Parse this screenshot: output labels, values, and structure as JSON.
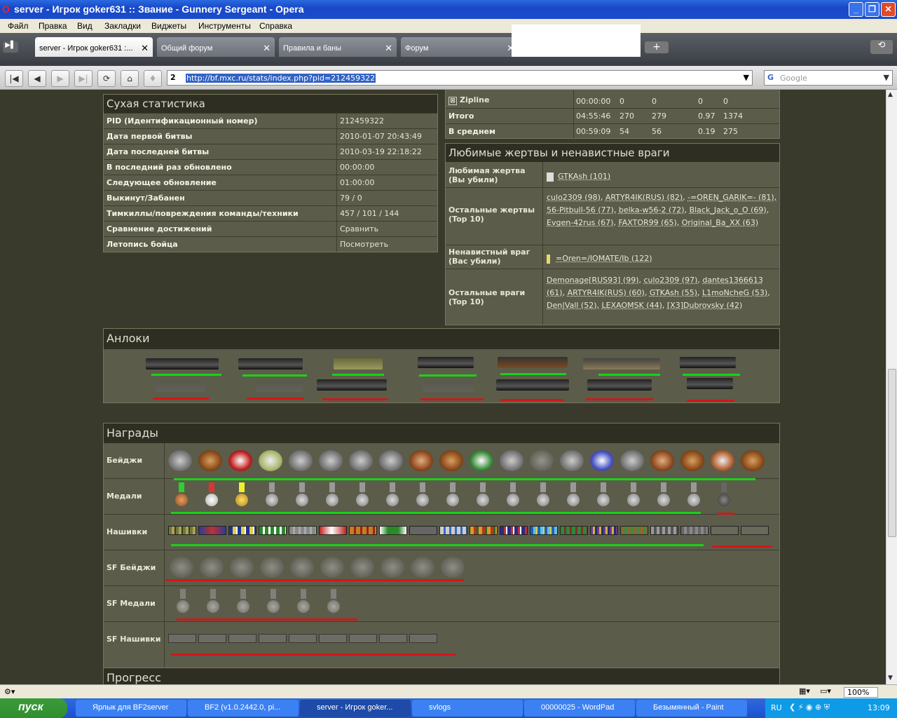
{
  "window": {
    "title": "server - Игрок goker631 :: Звание - Gunnery Sergeant - Opera",
    "logo": "O"
  },
  "menu": [
    "Файл",
    "Правка",
    "Вид",
    "Закладки",
    "Виджеты",
    "Инструменты",
    "Справка"
  ],
  "tabs": [
    {
      "label": "server - Игрок goker631 :..."
    },
    {
      "label": "Общий форум"
    },
    {
      "label": "Правила и баны"
    },
    {
      "label": "Форум"
    }
  ],
  "address": {
    "url": "http://bf.mxc.ru/stats/index.php?pid=212459322"
  },
  "search": {
    "placeholder": "Google"
  },
  "dry_stats": {
    "title": "Сухая статистика",
    "rows": [
      {
        "k": "PID (Идентификационный номер)",
        "v": "212459322"
      },
      {
        "k": "Дата первой битвы",
        "v": "2010-01-07 20:43:49"
      },
      {
        "k": "Дата последней битвы",
        "v": "2010-03-19 22:18:22"
      },
      {
        "k": "В последний раз обновлено",
        "v": "00:00:00"
      },
      {
        "k": "Следующее обновление",
        "v": "01:00:00"
      },
      {
        "k": "Выкинут/Забанен",
        "v": "79 / 0"
      },
      {
        "k": "Тимкиллы/повреждения команды/техники",
        "v": "457 / 101 / 144"
      },
      {
        "k": "Сравнение достижений",
        "v": "Сравнить"
      },
      {
        "k": "Летопись бойца",
        "v": "Посмотреть"
      }
    ]
  },
  "vehicle_rows": [
    {
      "name": "Zipline",
      "time": "00:00:00",
      "a": "0",
      "b": "0",
      "c": "0",
      "d": "0"
    },
    {
      "name": "Итого",
      "time": "04:55:46",
      "a": "270",
      "b": "279",
      "c": "0.97",
      "d": "1374"
    },
    {
      "name": "В среднем",
      "time": "00:59:09",
      "a": "54",
      "b": "56",
      "c": "0.19",
      "d": "275"
    }
  ],
  "enemies": {
    "title": "Любимые жертвы и ненавистные враги",
    "fav_victim_label": "Любимая жертва (Вы убили)",
    "fav_victim": "GTKAsh (101)",
    "other_victims_label": "Остальные жертвы (Top 10)",
    "other_victims": [
      "culo2309 (98),",
      "ARTYR4IK(RUS) (82),",
      "-=OREN_GARIK=- (81),",
      "56-Pitbull-56 (77),",
      "belka-w56-2 (72),",
      "Black_Jack_o_O (69),",
      "Evgen-42rus (67),",
      "FAXTOR99 (65),",
      "Original_Ba_XX (63)"
    ],
    "hated_label": "Ненавистный враг (Вас убили)",
    "hated": "=Oren=/IOMATE/Ib (122)",
    "other_enemies_label": "Остальные враги (Top 10)",
    "other_enemies": [
      "Demonage[RUS93] (99),",
      "culo2309 (97),",
      "dantes1366613 (61),",
      "ARTYR4IK(RUS) (60),",
      "GTKAsh (55),",
      "L1moNcheG (53),",
      "Den|Vall (52),",
      "LEXAOMSK (44),",
      "[X3]Dubrovsky (42)"
    ]
  },
  "unlocks": {
    "title": "Анлоки"
  },
  "awards": {
    "title": "Награды",
    "rows": [
      "Бейджи",
      "Медали",
      "Нашивки",
      "SF Бейджи",
      "SF Медали",
      "SF Нашивки"
    ]
  },
  "progress": {
    "title": "Прогресс"
  },
  "status": {
    "zoom": "100%"
  },
  "taskbar": {
    "start": "пуск",
    "items": [
      "Ярлык для BF2server",
      "BF2 (v1.0.2442.0, pi...",
      "server - Игрок goker...",
      "svlogs",
      "00000025 - WordPad",
      "Безымянный - Paint"
    ],
    "lang": "RU",
    "clock": "13:09"
  }
}
